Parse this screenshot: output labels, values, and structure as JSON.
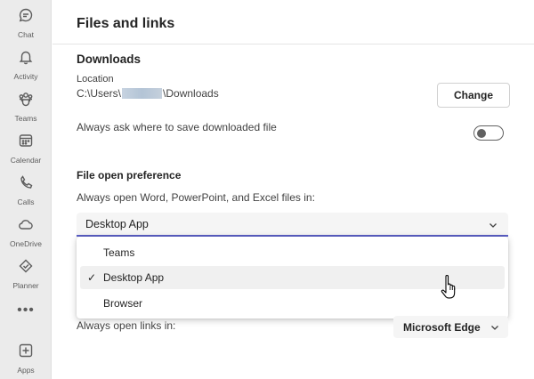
{
  "rail": {
    "items": [
      {
        "label": "Chat",
        "icon": "chat-icon"
      },
      {
        "label": "Activity",
        "icon": "bell-icon"
      },
      {
        "label": "Teams",
        "icon": "teams-icon"
      },
      {
        "label": "Calendar",
        "icon": "calendar-icon"
      },
      {
        "label": "Calls",
        "icon": "phone-icon"
      },
      {
        "label": "OneDrive",
        "icon": "cloud-icon"
      },
      {
        "label": "Planner",
        "icon": "planner-icon"
      }
    ],
    "more": "•••",
    "apps": {
      "label": "Apps",
      "icon": "add-apps-icon"
    }
  },
  "header": {
    "title": "Files and links"
  },
  "downloads": {
    "title": "Downloads",
    "location_label": "Location",
    "path_prefix": "C:\\Users\\",
    "path_suffix": "\\Downloads",
    "change_label": "Change",
    "ask_label": "Always ask where to save downloaded file",
    "ask_toggle_on": false
  },
  "file_pref": {
    "title": "File open preference",
    "label": "Always open Word, PowerPoint, and Excel files in:",
    "selected": "Desktop App",
    "options": [
      {
        "label": "Teams",
        "checked": false
      },
      {
        "label": "Desktop App",
        "checked": true
      },
      {
        "label": "Browser",
        "checked": false
      }
    ]
  },
  "links": {
    "label": "Always open links in:",
    "selected": "Microsoft Edge"
  },
  "colors": {
    "accent": "#5b5fc7",
    "rail_bg": "#ebebeb"
  }
}
